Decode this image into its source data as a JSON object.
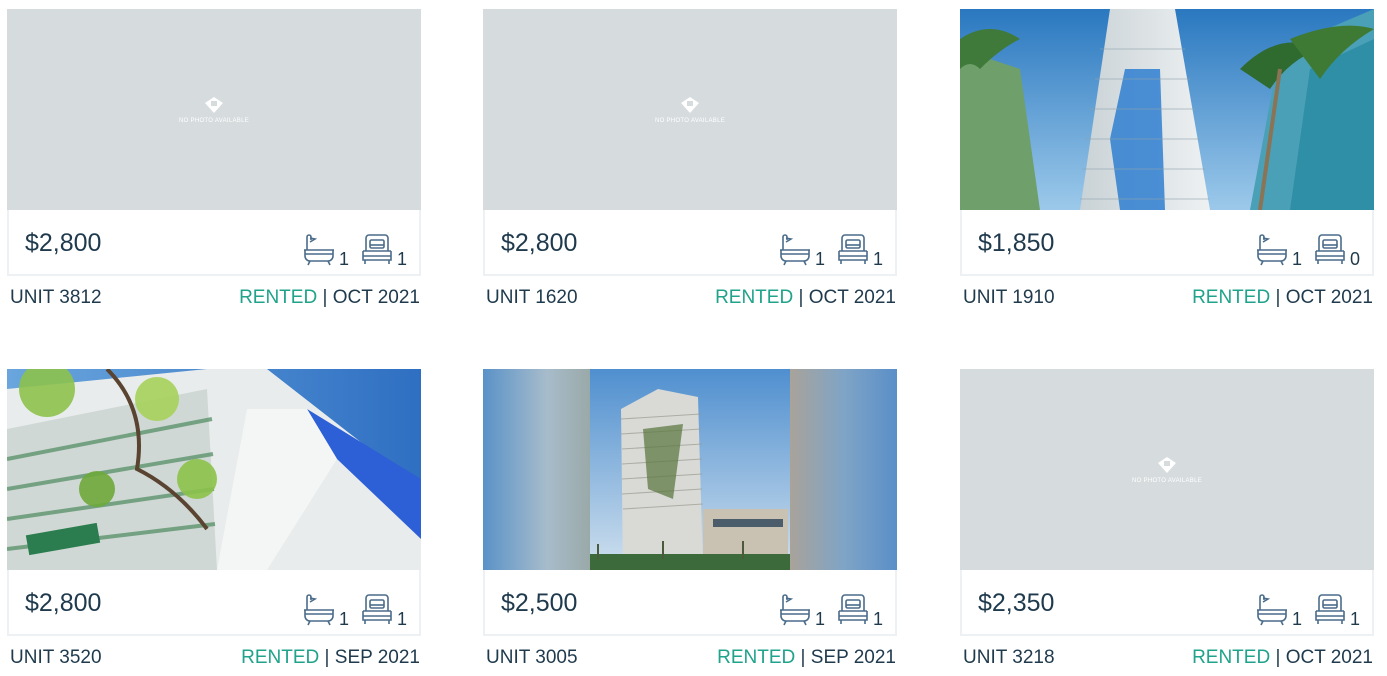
{
  "listings": [
    {
      "price": "$2,800",
      "baths": "1",
      "beds": "1",
      "unit": "UNIT 3812",
      "status": "RENTED",
      "sep": " | ",
      "date": "OCT 2021",
      "photo": "none",
      "no_photo_text": "NO PHOTO AVAILABLE"
    },
    {
      "price": "$2,800",
      "baths": "1",
      "beds": "1",
      "unit": "UNIT 1620",
      "status": "RENTED",
      "sep": " | ",
      "date": "OCT 2021",
      "photo": "none",
      "no_photo_text": "NO PHOTO AVAILABLE"
    },
    {
      "price": "$1,850",
      "baths": "1",
      "beds": "0",
      "unit": "UNIT 1910",
      "status": "RENTED",
      "sep": " | ",
      "date": "OCT 2021",
      "photo": "tower-blue-stripe"
    },
    {
      "price": "$2,800",
      "baths": "1",
      "beds": "1",
      "unit": "UNIT 3520",
      "status": "RENTED",
      "sep": " | ",
      "date": "SEP 2021",
      "photo": "building-with-tree"
    },
    {
      "price": "$2,500",
      "baths": "1",
      "beds": "1",
      "unit": "UNIT 3005",
      "status": "RENTED",
      "sep": " | ",
      "date": "SEP 2021",
      "photo": "tower-rendering"
    },
    {
      "price": "$2,350",
      "baths": "1",
      "beds": "1",
      "unit": "UNIT 3218",
      "status": "RENTED",
      "sep": " | ",
      "date": "OCT 2021",
      "photo": "none",
      "no_photo_text": "NO PHOTO AVAILABLE"
    }
  ],
  "colors": {
    "status": "#1fa38a",
    "text": "#1f3a4d",
    "placeholder": "#d6dbde",
    "icon": "#4a6c8a"
  },
  "icons": {
    "bath": "bathtub-icon",
    "bed": "bed-icon"
  }
}
